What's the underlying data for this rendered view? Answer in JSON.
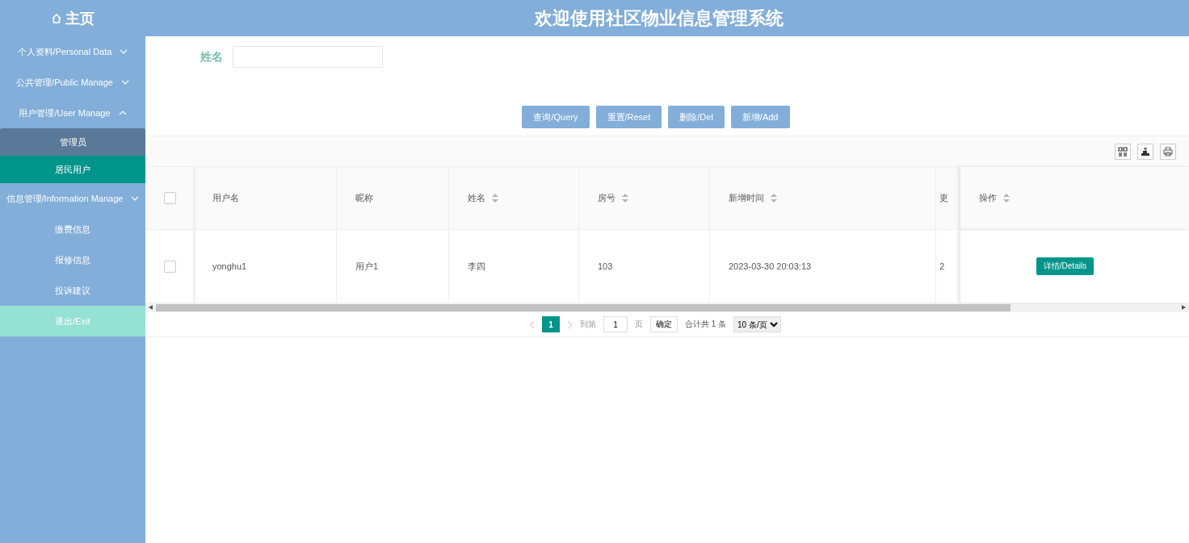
{
  "header": {
    "home": "主页",
    "title": "欢迎使用社区物业信息管理系统"
  },
  "sidebar": {
    "menus": [
      {
        "label": "个人资料/Personal Data",
        "expanded": false
      },
      {
        "label": "公共管理/Public Manage",
        "expanded": false
      },
      {
        "label": "用户管理/User Manage",
        "expanded": true,
        "children": [
          {
            "label": "管理员",
            "selected": false
          },
          {
            "label": "居民用户",
            "selected": true
          }
        ]
      },
      {
        "label": "信息管理/Information Manage",
        "expanded": false,
        "children": [
          {
            "label": "缴费信息",
            "selected": false
          },
          {
            "label": "报修信息",
            "selected": false
          },
          {
            "label": "投诉建议",
            "selected": false
          }
        ]
      }
    ],
    "exit": "退出/Exit"
  },
  "search": {
    "label": "姓名"
  },
  "buttons": [
    "查询/Query",
    "重置/Reset",
    "删除/Del",
    "新增/Add"
  ],
  "table": {
    "columns": [
      {
        "label": "用户名",
        "sortable": false
      },
      {
        "label": "昵称",
        "sortable": false
      },
      {
        "label": "姓名",
        "sortable": true
      },
      {
        "label": "房号",
        "sortable": true
      },
      {
        "label": "新增时间",
        "sortable": true
      },
      {
        "label": "更",
        "sortable": false
      },
      {
        "label": "操作",
        "sortable": true
      }
    ],
    "rows": [
      {
        "checked": false,
        "cells": [
          "yonghu1",
          "用户1",
          "李四",
          "103",
          "2023-03-30 20:03:13",
          "2"
        ],
        "action": "详情/Details"
      }
    ],
    "header_checked": false
  },
  "pagination": {
    "pages": [
      {
        "label": "1",
        "selected": true
      }
    ],
    "goto_label": "到第",
    "goto_value": "1",
    "page_unit": "页",
    "confirm": "确定",
    "total": "合计共 1 条",
    "page_size": "10 条/页"
  }
}
